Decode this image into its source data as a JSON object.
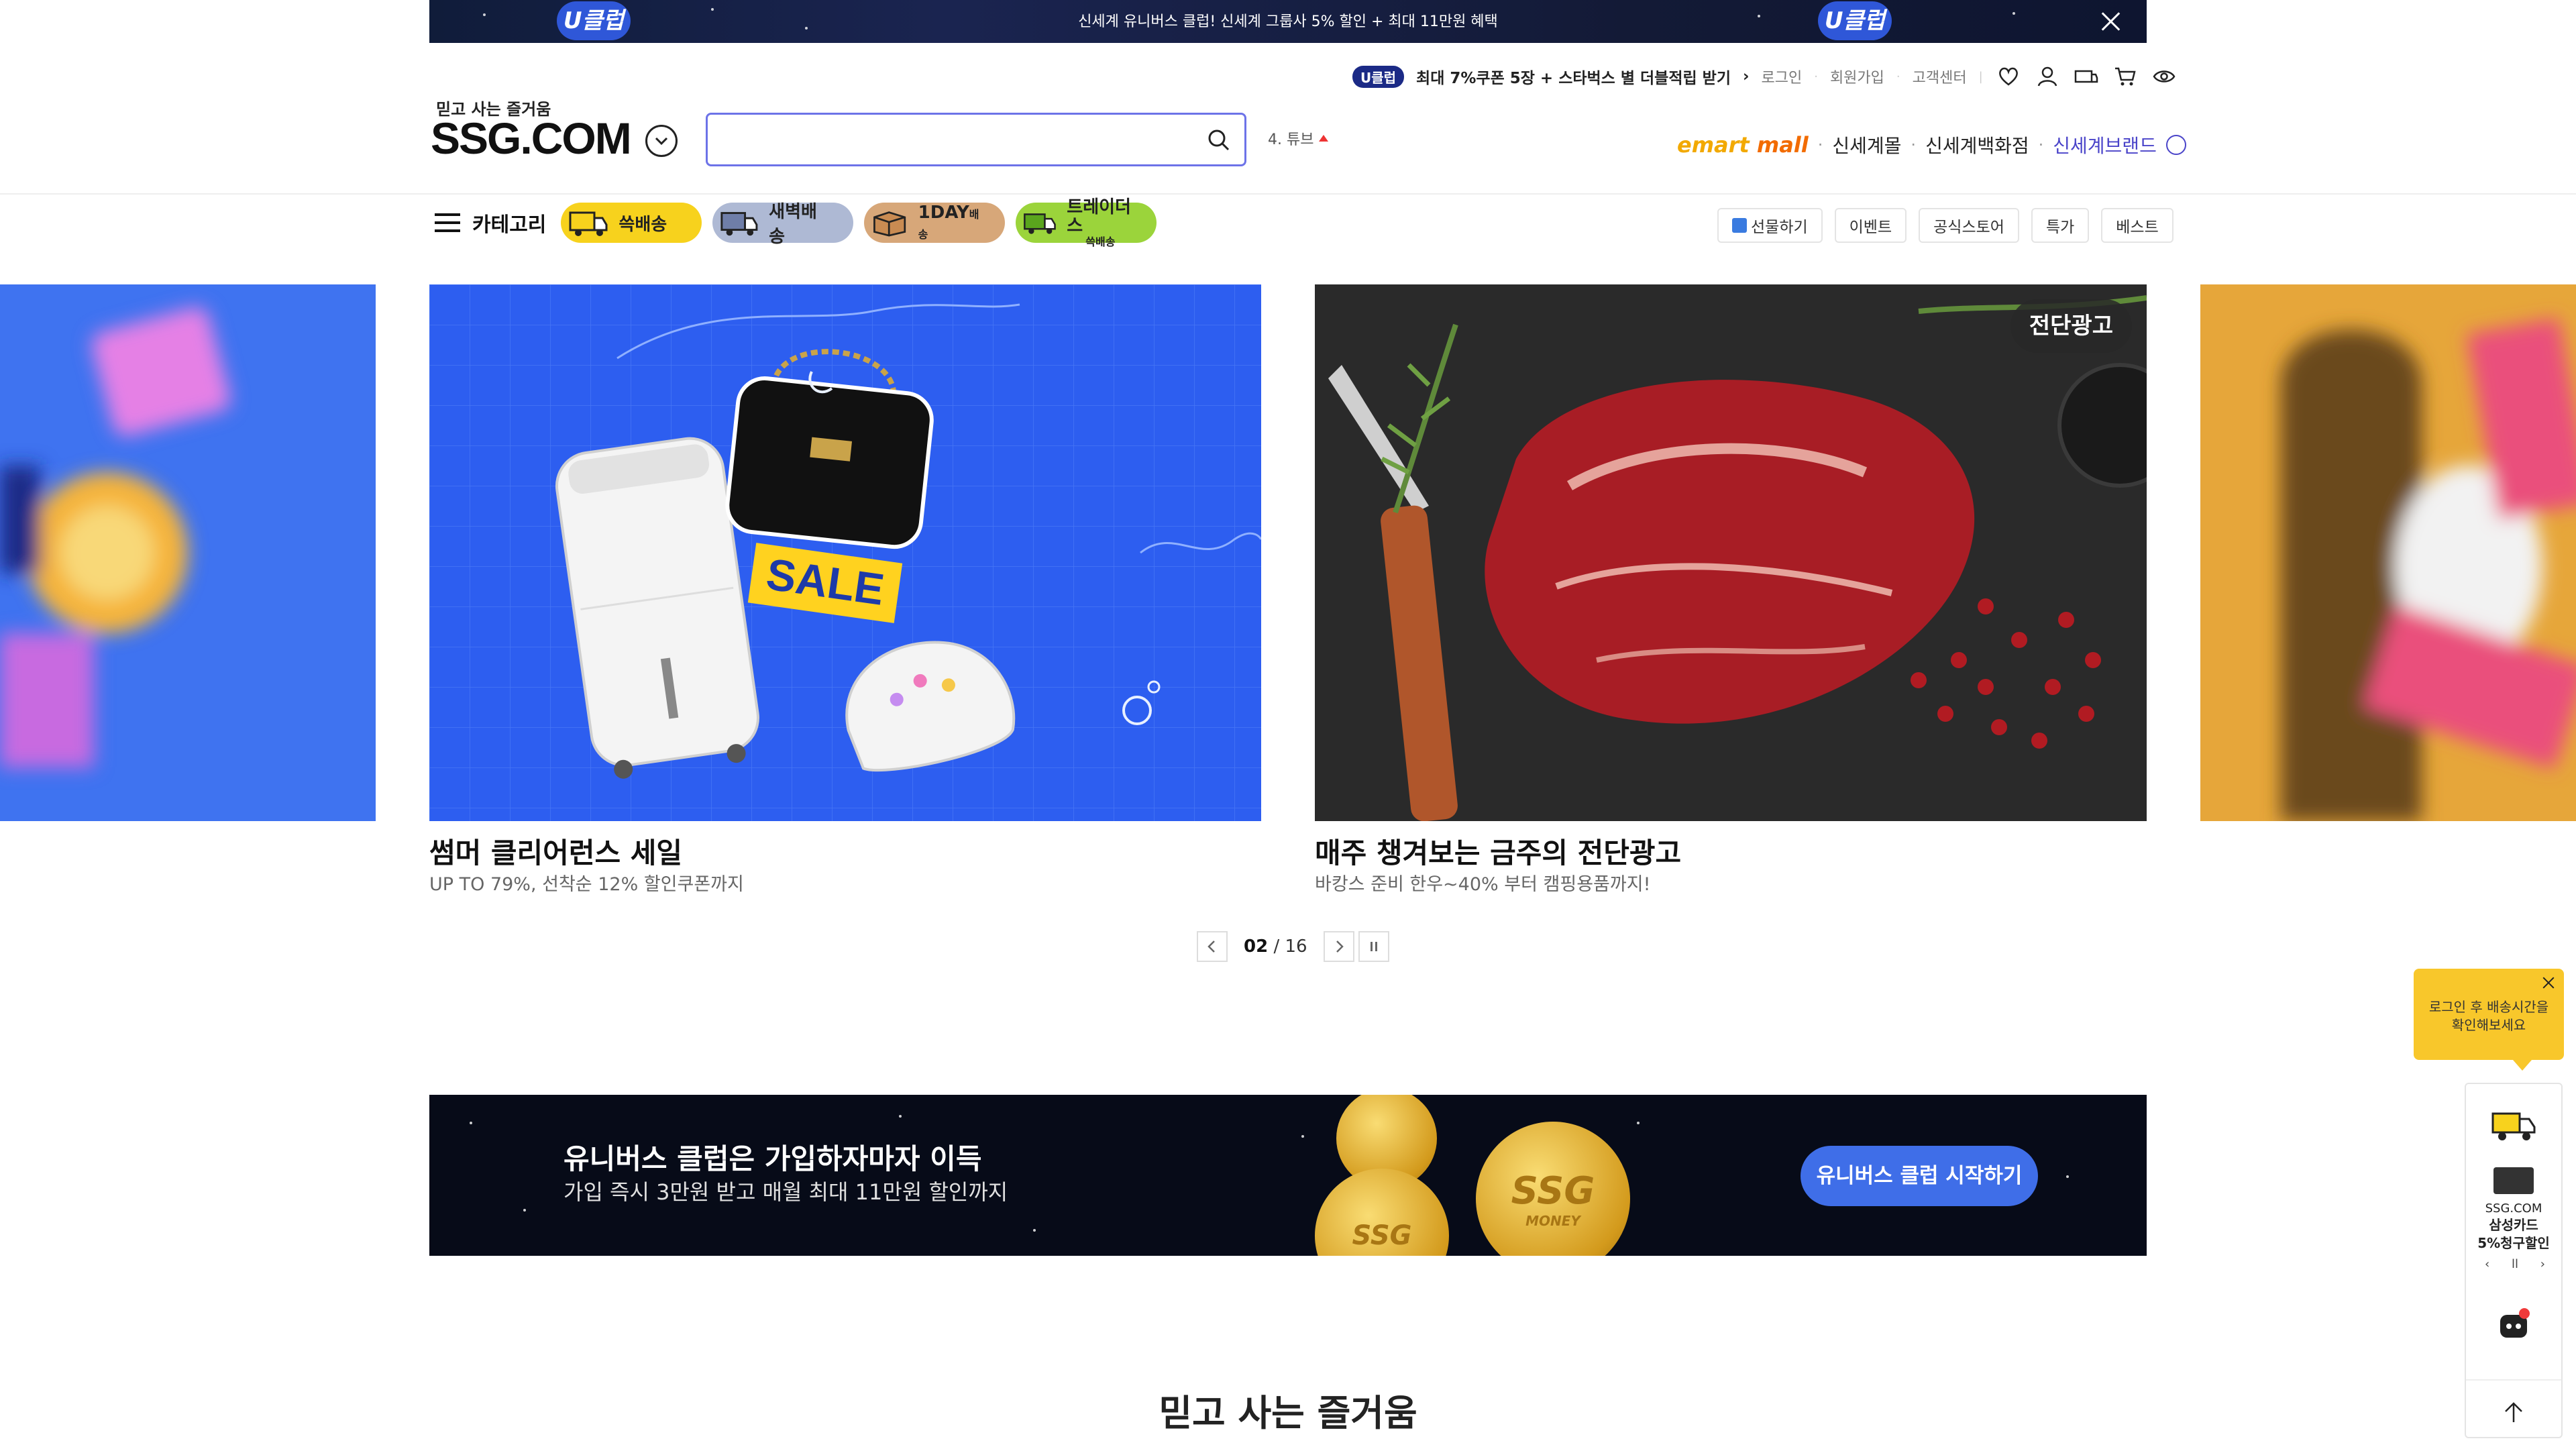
{
  "topbar": {
    "text": "신세계 유니버스 클럽! 신세계 그룹사 5% 할인 + 최대 11만원 혜택",
    "badge": "U클럽"
  },
  "util": {
    "uclub_pill": "U클럽",
    "promo": "최대 7%쿠폰 5장 + 스타벅스 별 더블적립 받기",
    "login": "로그인",
    "signup": "회원가입",
    "support": "고객센터"
  },
  "header": {
    "logo_sub": "믿고 사는 즐거움",
    "logo": "SSG.COM",
    "search_placeholder": "",
    "trend": "4. 튜브"
  },
  "malls": {
    "emart": "emart",
    "emart_mall": "mall",
    "shinsegae_mall": "신세계몰",
    "shinsegae_dept": "신세계백화점",
    "shinsegae_brand": "신세계브랜드"
  },
  "categories": {
    "menu": "카테고리",
    "pills": [
      "쓱배송",
      "새벽배송",
      "1DAY",
      "트레이더스"
    ],
    "day_suffix": "배송",
    "traders_sub": "쓱배송"
  },
  "chips": [
    "선물하기",
    "이벤트",
    "공식스토어",
    "특가",
    "베스트"
  ],
  "slides": [
    {
      "title": "썸머 클리어런스 세일",
      "subtitle": "UP TO 79%, 선착순 12% 할인쿠폰까지",
      "art_text": "SALE"
    },
    {
      "title": "매주 챙겨보는 금주의 전단광고",
      "subtitle": "바캉스 준비 한우~40% 부터 캠핑용품까지!",
      "badge": "전단광고"
    }
  ],
  "pager": {
    "current": "02",
    "total": "16"
  },
  "universe": {
    "title": "유니버스 클럽은 가입하자마자 이득",
    "subtitle": "가입 즉시 3만원 받고 매월 최대 11만원 할인까지",
    "button": "유니버스 클럽 시작하기",
    "coin_text": "SSG",
    "coin_sub": "MONEY"
  },
  "bottom": {
    "title": "믿고 사는 즐거움"
  },
  "side": {
    "tooltip": "로그인 후 배송시간을 확인해보세요",
    "card_brand": "SSG.COM",
    "card_name": "삼성카드",
    "card_offer": "5%청구할인"
  },
  "colors": {
    "accent": "#6d73e8",
    "brand_link": "#4a44c9",
    "universe_btn": "#3f6ee8",
    "tooltip": "#f8c72b"
  }
}
